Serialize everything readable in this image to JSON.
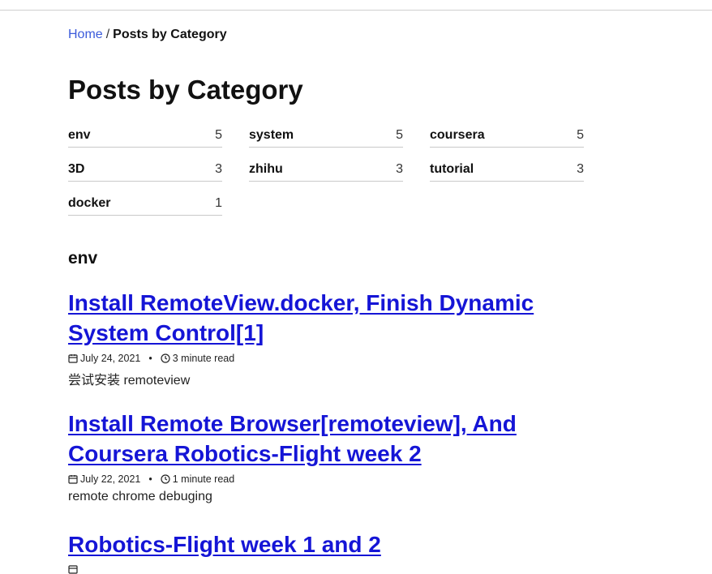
{
  "breadcrumb": {
    "home": "Home",
    "separator": "/",
    "current": "Posts by Category"
  },
  "page": {
    "title": "Posts by Category"
  },
  "categories": [
    {
      "name": "env",
      "count": "5"
    },
    {
      "name": "system",
      "count": "5"
    },
    {
      "name": "coursera",
      "count": "5"
    },
    {
      "name": "3D",
      "count": "3"
    },
    {
      "name": "zhihu",
      "count": "3"
    },
    {
      "name": "tutorial",
      "count": "3"
    },
    {
      "name": "docker",
      "count": "1"
    }
  ],
  "section": {
    "heading": "env"
  },
  "posts": [
    {
      "title": "Install RemoteView.docker, Finish Dynamic System Control[1]",
      "date": "July 24, 2021",
      "read_time": "3 minute read",
      "excerpt": "尝试安装 remoteview"
    },
    {
      "title": "Install Remote Browser[remoteview], And Coursera Robotics-Flight week 2",
      "date": "July 22, 2021",
      "read_time": "1 minute read",
      "excerpt": "remote chrome debuging"
    },
    {
      "title": "Robotics-Flight week 1 and 2",
      "date": "",
      "read_time": "",
      "excerpt": ""
    }
  ],
  "meta": {
    "bullet": "•"
  },
  "icons": {
    "date": "calendar-icon",
    "time": "clock-icon"
  }
}
